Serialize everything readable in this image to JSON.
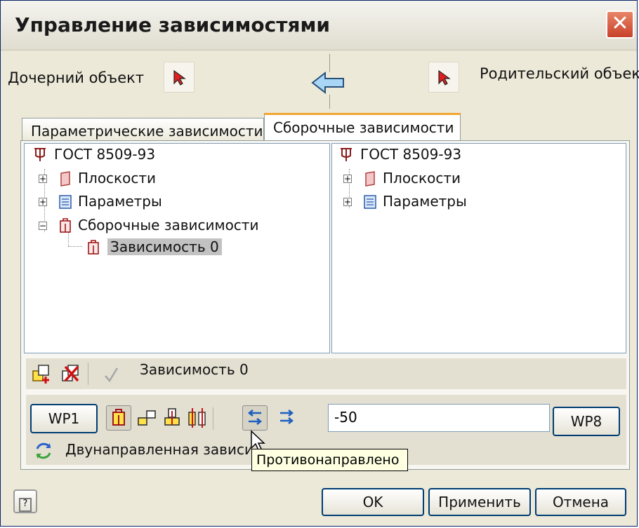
{
  "window": {
    "title": "Управление зависимостями",
    "close_icon": "close-icon"
  },
  "top": {
    "child_label": "Дочерний объект",
    "parent_label": "Родительский объект",
    "direction_icon": "arrow-left-icon"
  },
  "tabs": [
    {
      "label": "Параметрические зависимости",
      "active": false
    },
    {
      "label": "Сборочные зависимости",
      "active": true
    }
  ],
  "left_tree": {
    "root": "ГОСТ 8509-93",
    "items": [
      "Плоскости",
      "Параметры",
      "Сборочные зависимости"
    ],
    "child": "Зависимость 0"
  },
  "right_tree": {
    "root": "ГОСТ 8509-93",
    "items": [
      "Плоскости",
      "Параметры"
    ]
  },
  "toolbar": {
    "dependency_name": "Зависимость 0"
  },
  "constraint": {
    "wp_left": "WP1",
    "wp_right": "WP8",
    "offset_value": "-50",
    "bidirectional_label": "Двунаправленная зависи",
    "tooltip": "Противонаправлено"
  },
  "footer": {
    "ok": "OK",
    "apply": "Применить",
    "cancel": "Отмена"
  },
  "colors": {
    "accent": "#f3a530",
    "title_bar": "#e0ddd0",
    "selection": "#c2c2c2"
  }
}
